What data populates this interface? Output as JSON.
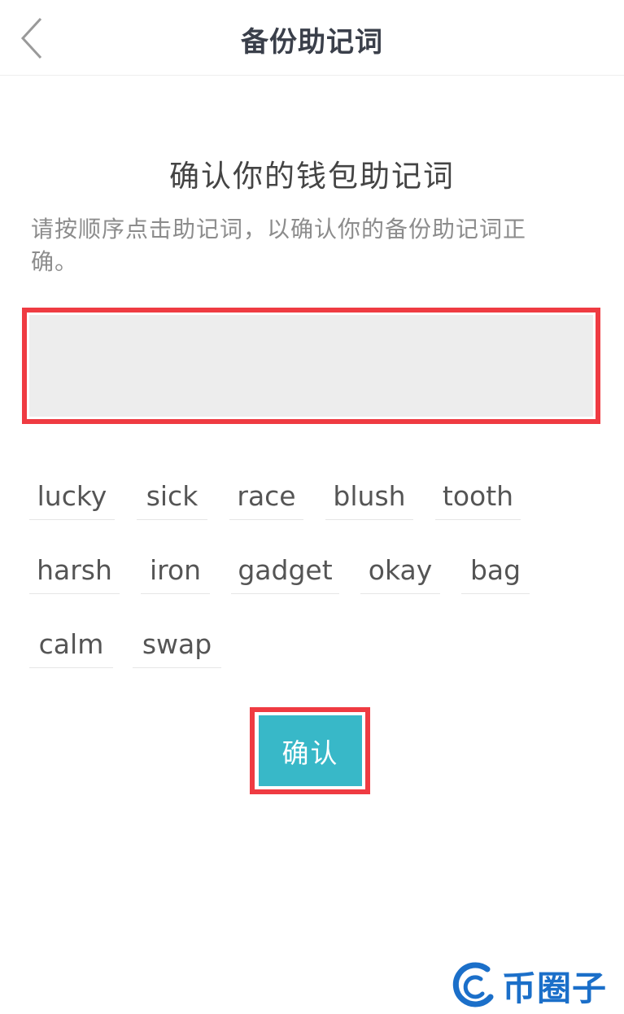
{
  "header": {
    "title": "备份助记词",
    "back_icon": "chevron-left-icon"
  },
  "main": {
    "title": "确认你的钱包助记词",
    "instruction": "请按顺序点击助记词，以确认你的备份助记词正确。",
    "selected_words": [],
    "words": [
      "lucky",
      "sick",
      "race",
      "blush",
      "tooth",
      "harsh",
      "iron",
      "gadget",
      "okay",
      "bag",
      "calm",
      "swap"
    ],
    "confirm_label": "确认"
  },
  "watermark": {
    "text": "币圈子"
  },
  "colors": {
    "accent": "#38b8c8",
    "highlight_border": "#ef3b42",
    "watermark": "#1b6fc9"
  }
}
